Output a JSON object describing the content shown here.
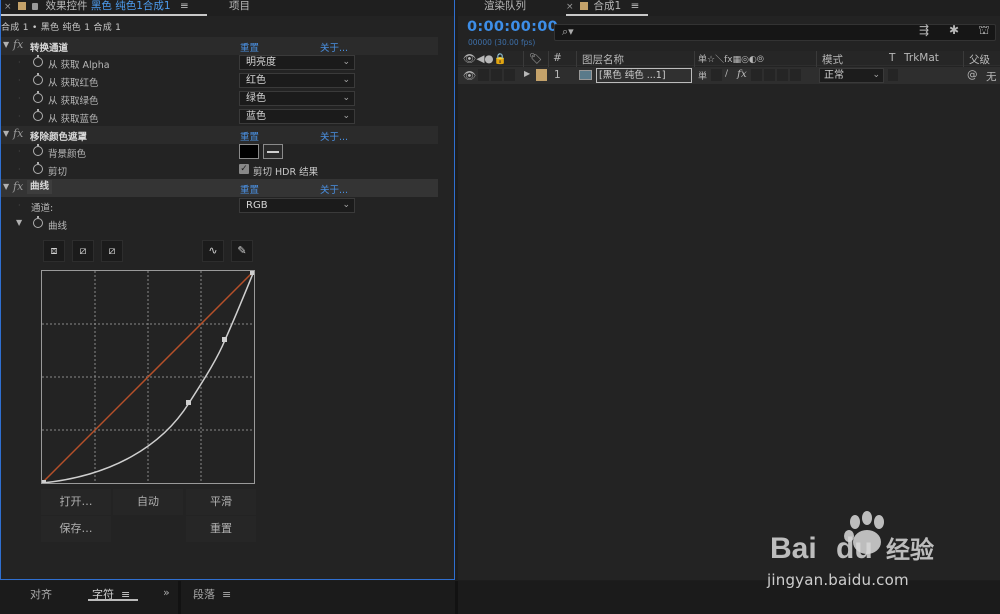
{
  "effect_controls": {
    "tab_label_prefix": "效果控件",
    "tab_label_layer": "黑色 纯色1",
    "tab_label_comp": "合成1",
    "tab_menu": "≡",
    "tab_project": "项目",
    "breadcrumb": "合成 1 • 黑色 纯色 1 合成 1",
    "effects": [
      {
        "name": "转换通道",
        "reset": "重置",
        "about": "关于...",
        "props": [
          {
            "label": "从 获取 Alpha",
            "value": "明亮度"
          },
          {
            "label": "从 获取红色",
            "value": "红色"
          },
          {
            "label": "从 获取绿色",
            "value": "绿色"
          },
          {
            "label": "从 获取蓝色",
            "value": "蓝色"
          }
        ]
      },
      {
        "name": "移除颜色遮罩",
        "reset": "重置",
        "about": "关于...",
        "props": [
          {
            "label": "背景颜色",
            "color": "#000000"
          },
          {
            "label": "剪切",
            "checkbox_label": "剪切 HDR 结果",
            "checked": true
          }
        ]
      },
      {
        "name": "曲线",
        "reset": "重置",
        "about": "关于...",
        "channel_label": "通道:",
        "channel_value": "RGB",
        "curve_label": "曲线",
        "buttons": {
          "open": "打开…",
          "auto": "自动",
          "smooth": "平滑",
          "save": "保存…",
          "reset": "重置"
        }
      }
    ]
  },
  "timeline": {
    "render_queue_tab": "渲染队列",
    "comp_tab": "合成1",
    "tab_menu": "≡",
    "timecode": "0:00:00:00",
    "fps": "00000 (30.00 fps)",
    "search_icon": "search-icon",
    "columns": {
      "hash": "#",
      "layer_name": "图层名称",
      "switches": "单☆＼fx▦◎◐⦾",
      "mode": "模式",
      "t": "T",
      "trkmat": "TrkMat",
      "parent": "父级"
    },
    "layers": [
      {
        "index": "1",
        "name": "[黑色 纯色 ...1]",
        "mode": "正常",
        "parent": "无",
        "label_color": "#c4a26a"
      }
    ]
  },
  "bottom_panels": {
    "align": "对齐",
    "character": "字符",
    "character_menu": "≡",
    "expand": "»",
    "paragraph": "段落",
    "paragraph_menu": "≡"
  },
  "watermark": {
    "brand": "Bai du 经验",
    "url": "jingyan.baidu.com"
  },
  "colors": {
    "accent_blue": "#3d8ee8",
    "curve_line": "#c8c8c8",
    "diagonal": "#b5502a",
    "label_tan": "#c4a26a"
  }
}
